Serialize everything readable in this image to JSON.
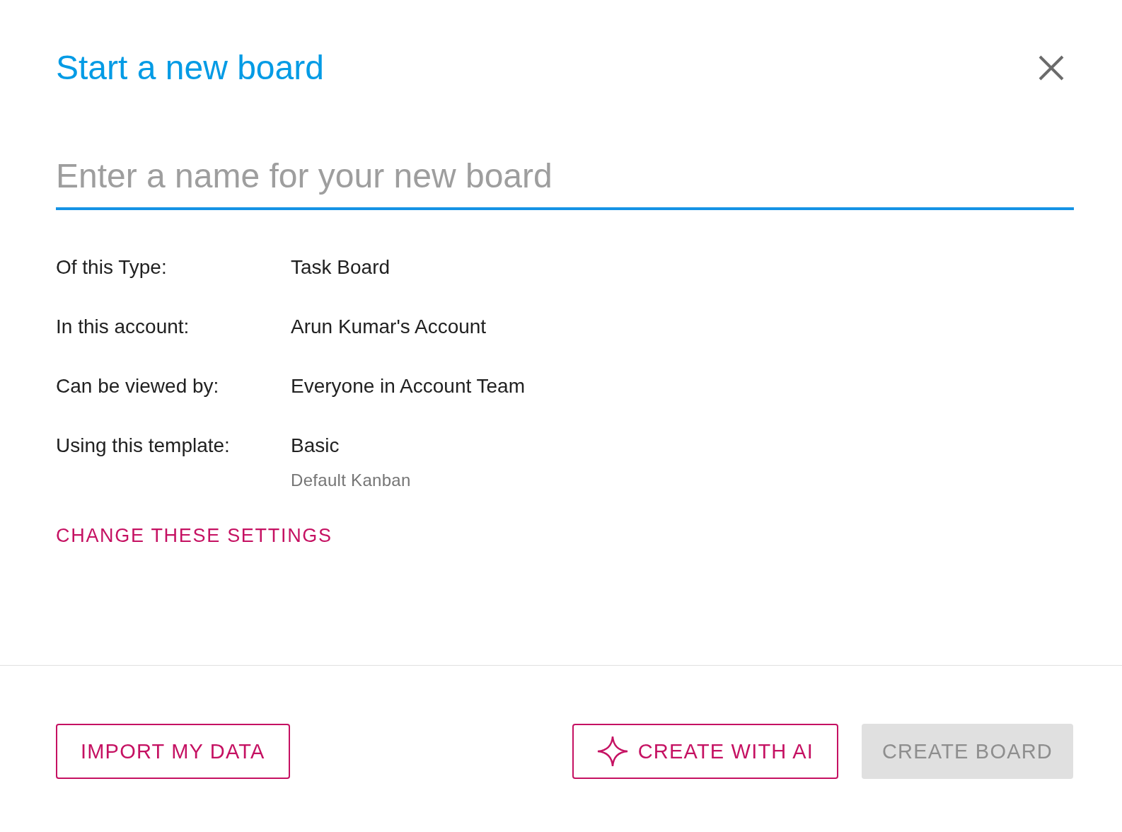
{
  "dialog": {
    "title": "Start a new board",
    "name_field": {
      "placeholder": "Enter a name for your new board",
      "focused": true
    },
    "settings": [
      {
        "label": "Of this Type:",
        "value": "Task Board"
      },
      {
        "label": "In this account:",
        "value": "Arun Kumar's Account"
      },
      {
        "label": "Can be viewed by:",
        "value": "Everyone in Account Team"
      },
      {
        "label": "Using this template:",
        "value": "Basic",
        "note": "Default Kanban"
      }
    ],
    "change_link": "CHANGE THESE SETTINGS",
    "buttons": [
      {
        "label": "IMPORT MY DATA",
        "kind": "outlined",
        "disabled": false
      },
      {
        "label": "CREATE WITH AI",
        "kind": "ai",
        "disabled": false
      },
      {
        "label": "CREATE BOARD",
        "kind": "contained",
        "disabled": true
      }
    ]
  }
}
